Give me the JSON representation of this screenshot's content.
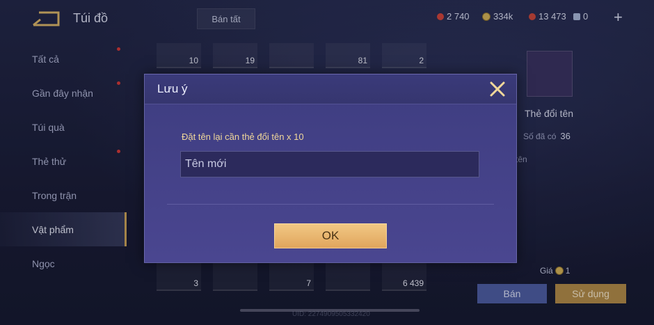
{
  "header": {
    "title": "Túi đồ",
    "sell_all_label": "Bán tất",
    "currencies": [
      {
        "name": "red-gem",
        "value": "2 740",
        "color": "#d0453d"
      },
      {
        "name": "gold-coin",
        "value": "334k",
        "color": "#d4b15a"
      },
      {
        "name": "ruby",
        "value": "13 473",
        "color": "#c9473c"
      },
      {
        "name": "voucher",
        "value": "0",
        "color": "#a8b6d8"
      }
    ],
    "add_label": "+"
  },
  "sidebar": {
    "items": [
      {
        "label": "Tất cả",
        "dot": true
      },
      {
        "label": "Gần đây nhận",
        "dot": true
      },
      {
        "label": "Túi quà",
        "dot": false
      },
      {
        "label": "Thẻ thử",
        "dot": true
      },
      {
        "label": "Trong trận",
        "dot": false
      },
      {
        "label": "Vật phẩm",
        "dot": false,
        "active": true
      },
      {
        "label": "Ngọc",
        "dot": false
      }
    ]
  },
  "grid": {
    "top_row": [
      "10",
      "19",
      "",
      "81",
      "2"
    ],
    "bottom_row": [
      "3",
      "",
      "7",
      "",
      "6 439"
    ]
  },
  "detail": {
    "name": "Thẻ đổi tên",
    "owned_label": "Số đã có",
    "owned_value": "36",
    "desc_partial": "tên",
    "price_label": "Giá",
    "price_value": "1",
    "sell_label": "Bán",
    "use_label": "Sử dụng"
  },
  "footer": {
    "uid": "UID: 2274909505332420"
  },
  "dialog": {
    "title": "Lưu ý",
    "message": "Đặt tên lại cần thẻ đổi tên x 10",
    "input_placeholder": "Tên mới",
    "ok_label": "OK"
  }
}
